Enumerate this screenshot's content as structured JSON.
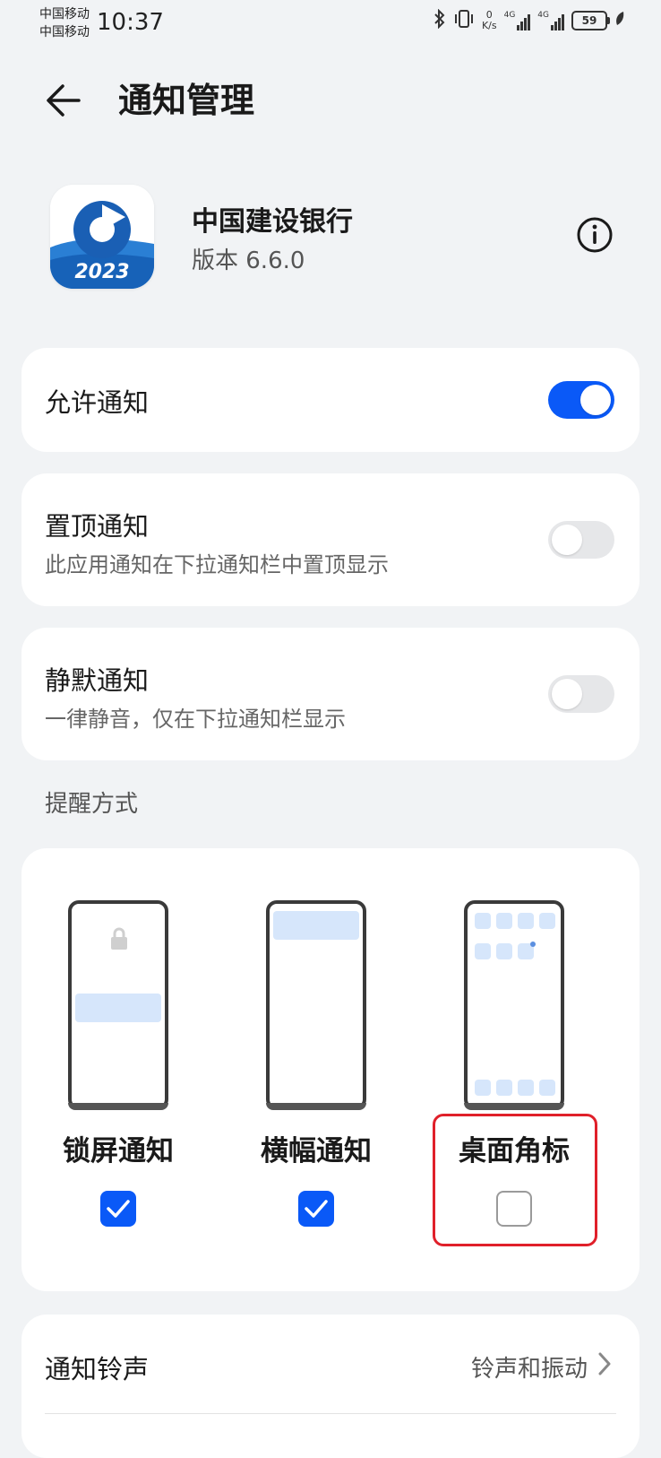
{
  "status_bar": {
    "carrier_1": "中国移动",
    "carrier_2": "中国移动",
    "time": "10:37",
    "net_speed_value": "0",
    "net_speed_unit": "K/s",
    "signal_1_label": "4G",
    "signal_2_label": "4G",
    "battery": "59"
  },
  "header": {
    "title": "通知管理"
  },
  "app": {
    "name": "中国建设银行",
    "version": "版本 6.6.0",
    "icon_year": "2023"
  },
  "settings": {
    "allow_notifications": {
      "label": "允许通知",
      "enabled": true
    },
    "pin_notifications": {
      "label": "置顶通知",
      "description": "此应用通知在下拉通知栏中置顶显示",
      "enabled": false
    },
    "silent_notifications": {
      "label": "静默通知",
      "description": "一律静音，仅在下拉通知栏显示",
      "enabled": false
    }
  },
  "reminder_section": {
    "label": "提醒方式",
    "options": [
      {
        "label": "锁屏通知",
        "checked": true
      },
      {
        "label": "横幅通知",
        "checked": true
      },
      {
        "label": "桌面角标",
        "checked": false
      }
    ]
  },
  "sound_row": {
    "label": "通知铃声",
    "value": "铃声和振动"
  },
  "colors": {
    "accent": "#0a59f7",
    "background": "#f1f3f5",
    "highlight": "#e0202a"
  }
}
